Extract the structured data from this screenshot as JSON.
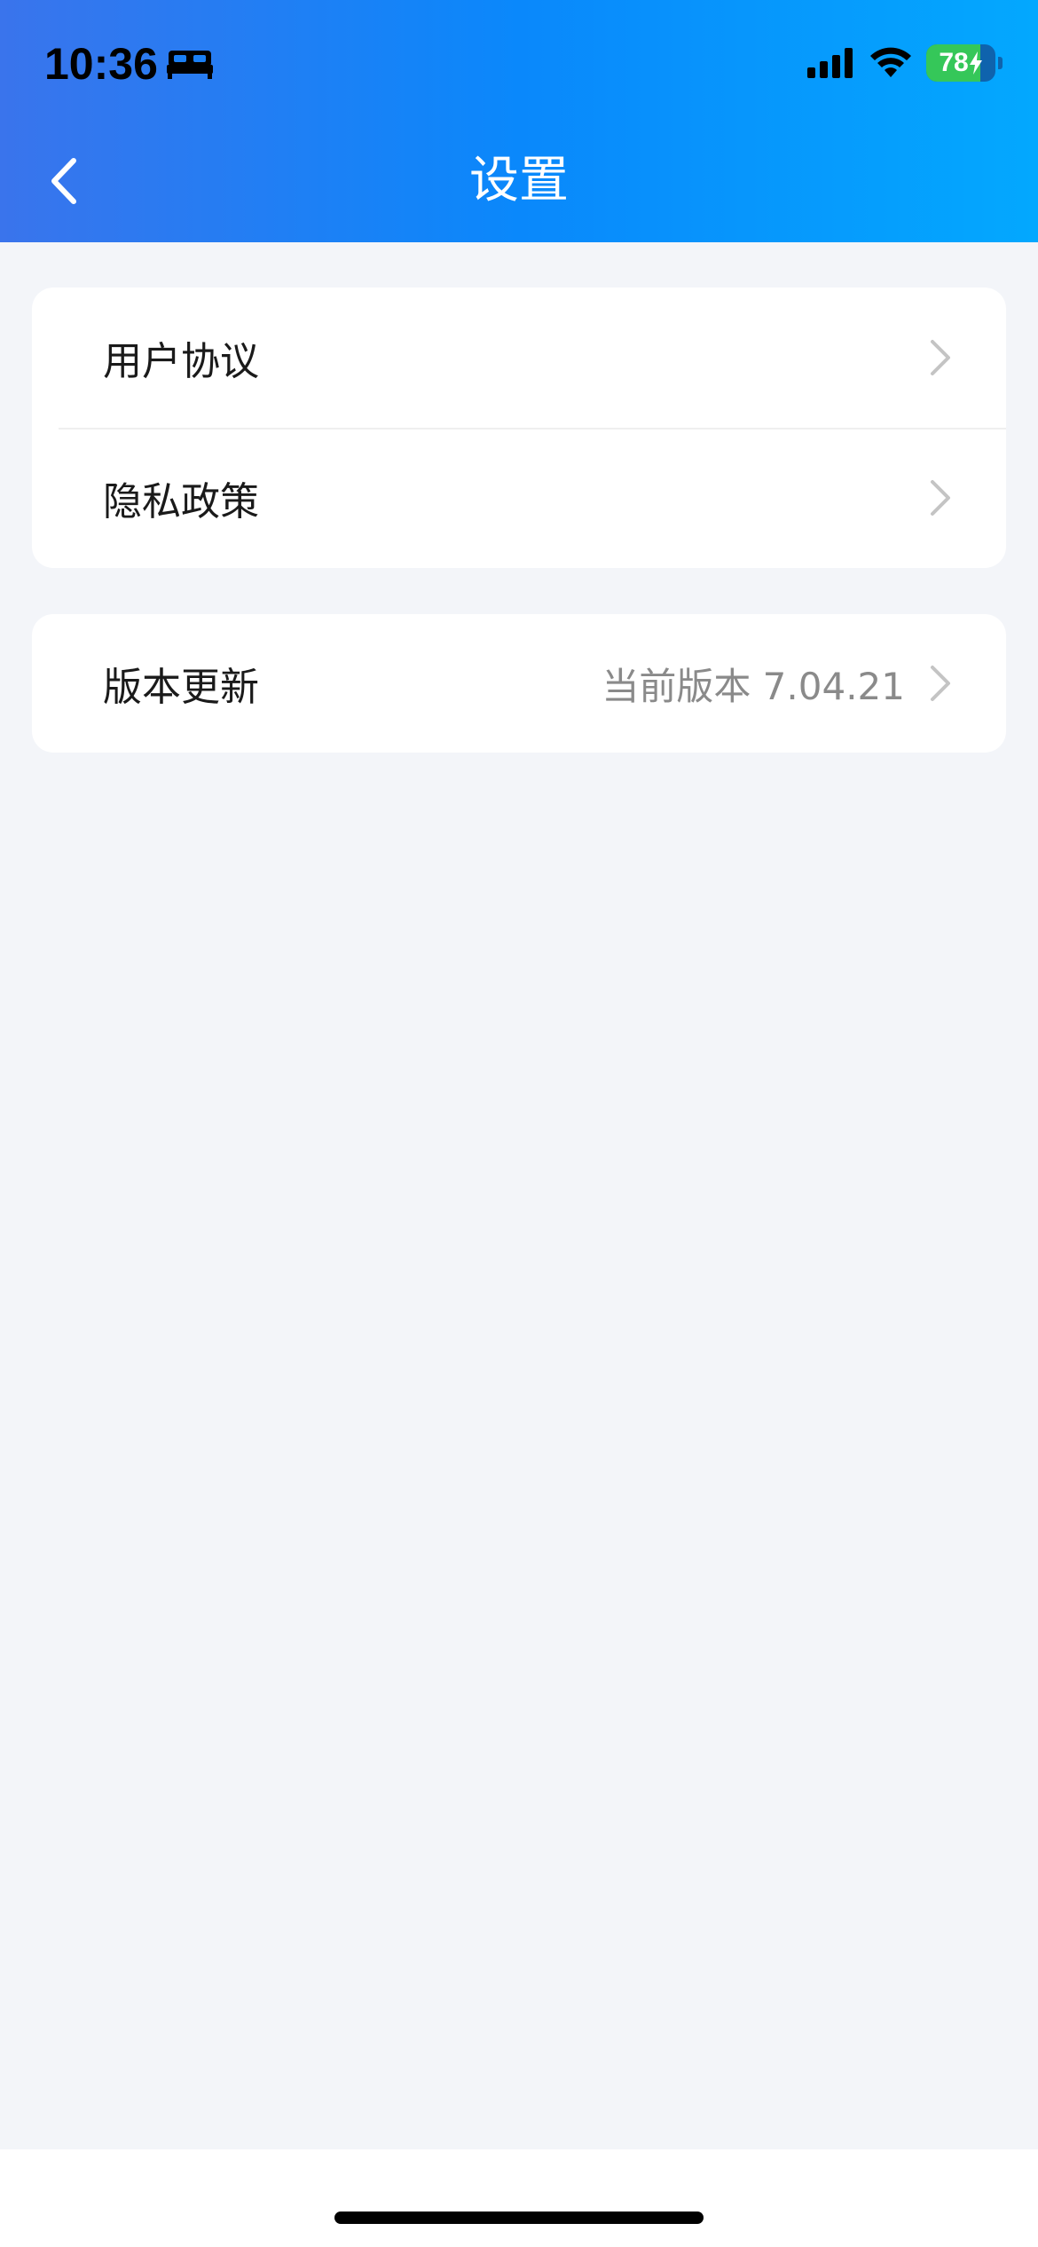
{
  "status_bar": {
    "time": "10:36",
    "focus_icon": "bed-icon",
    "signal_icon": "cellular-signal-icon",
    "wifi_icon": "wifi-icon",
    "battery_level": 78,
    "battery_text": "78",
    "battery_charging": true
  },
  "nav": {
    "back_icon": "chevron-left-icon",
    "title": "设置"
  },
  "settings": {
    "group1": [
      {
        "label": "用户协议"
      },
      {
        "label": "隐私政策"
      }
    ],
    "group2": [
      {
        "label": "版本更新",
        "value": "当前版本 7.04.21"
      }
    ]
  },
  "colors": {
    "header_gradient_start": "#3a74ec",
    "header_gradient_end": "#03a8fe",
    "background": "#f3f5f9",
    "battery_green": "#35c759"
  }
}
